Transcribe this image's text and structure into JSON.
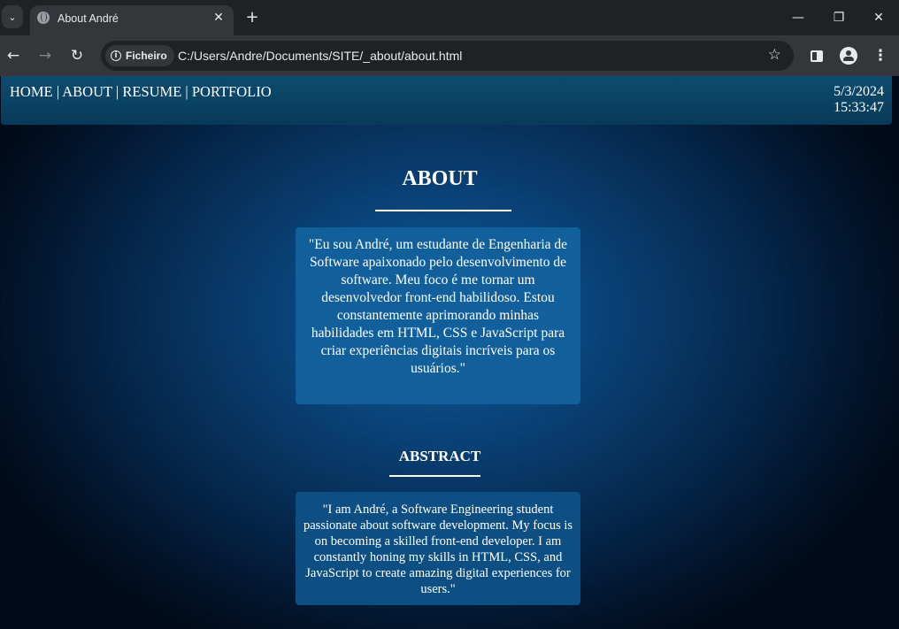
{
  "browser": {
    "tab": {
      "title": "About André"
    },
    "address_bar": {
      "chip_label": "Ficheiro",
      "url": "C:/Users/Andre/Documents/SITE/_about/about.html"
    }
  },
  "site": {
    "nav": {
      "home": "HOME",
      "about": "ABOUT",
      "resume": "RESUME",
      "portfolio": "PORTFOLIO",
      "separator": " | "
    },
    "date": "5/3/2024",
    "time": "15:33:47",
    "about": {
      "heading": "ABOUT",
      "text": "\"Eu sou André, um estudante de Engenharia de Software apaixonado pelo desenvolvimento de software. Meu foco é me tornar um desenvolvedor front-end habilidoso. Estou constantemente aprimorando minhas habilidades em HTML, CSS e JavaScript para criar experiências digitais incríveis para os usuários.\""
    },
    "abstract": {
      "heading": "ABSTRACT",
      "text": "\"I am André, a Software Engineering student passionate about software development. My focus is on becoming a skilled front-end developer. I am constantly honing my skills in HTML, CSS, and JavaScript to create amazing digital experiences for users.\""
    }
  }
}
